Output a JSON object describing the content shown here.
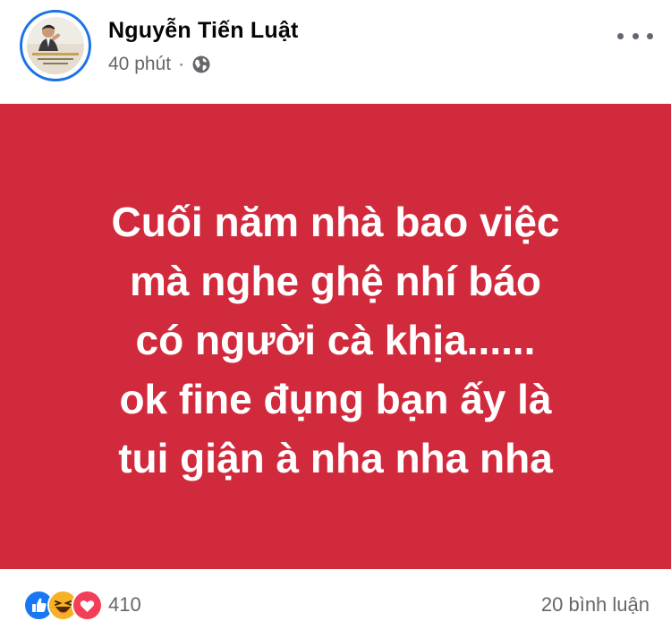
{
  "post": {
    "author": "Nguyễn Tiến Luật",
    "time": "40 phút",
    "separator": "·",
    "privacy_icon": "globe-icon",
    "more_icon": "more-options-icon"
  },
  "banner": {
    "background_color": "#d12a3c",
    "lines": [
      "Cuối năm nhà bao việc",
      "mà nghe ghệ nhí báo",
      "có người cà khịa......",
      "ok fine đụng bạn ấy là",
      "tui giận à nha nha nha"
    ]
  },
  "footer": {
    "reaction_icons": [
      "like-icon",
      "haha-icon",
      "love-icon"
    ],
    "reaction_count": "410",
    "comment_count": "20 bình luận"
  },
  "colors": {
    "like": "#1877f2",
    "haha": "#f7b125",
    "love": "#f33e58",
    "avatar_ring": "#1b74e4",
    "meta_text": "#65676b"
  }
}
